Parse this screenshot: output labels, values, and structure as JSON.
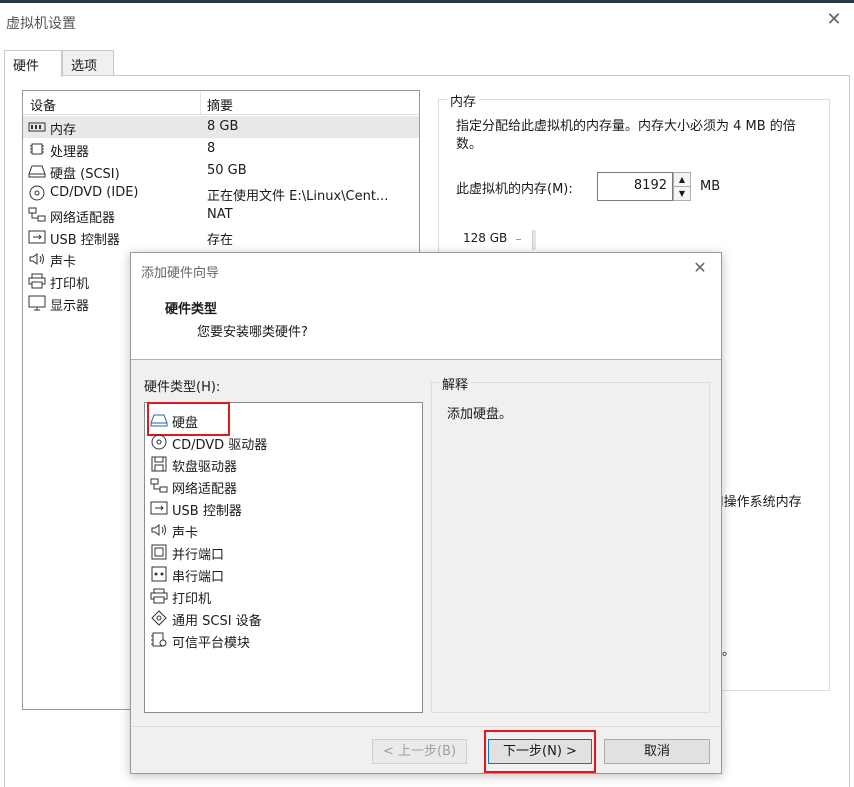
{
  "window": {
    "title": "虚拟机设置",
    "close": "✕"
  },
  "tabs": [
    {
      "label": "硬件",
      "active": true
    },
    {
      "label": "选项",
      "active": false
    }
  ],
  "device_list": {
    "columns": [
      "设备",
      "摘要"
    ],
    "rows": [
      {
        "name": "内存",
        "summary": "8 GB",
        "icon": "memory-icon",
        "selected": true
      },
      {
        "name": "处理器",
        "summary": "8",
        "icon": "processor-icon"
      },
      {
        "name": "硬盘 (SCSI)",
        "summary": "50 GB",
        "icon": "hard-disk-icon"
      },
      {
        "name": "CD/DVD (IDE)",
        "summary": "正在使用文件 E:\\Linux\\Cent...",
        "icon": "cd-dvd-icon"
      },
      {
        "name": "网络适配器",
        "summary": "NAT",
        "icon": "network-adapter-icon"
      },
      {
        "name": "USB 控制器",
        "summary": "存在",
        "icon": "usb-icon"
      },
      {
        "name": "声卡",
        "summary": "",
        "icon": "sound-card-icon"
      },
      {
        "name": "打印机",
        "summary": "",
        "icon": "printer-icon"
      },
      {
        "name": "显示器",
        "summary": "",
        "icon": "display-icon"
      }
    ]
  },
  "memory": {
    "group_title": "内存",
    "description": "指定分配给此虚拟机的内存量。内存大小必须为 4 MB 的倍数。",
    "label": "此虚拟机的内存(M):",
    "value": "8192",
    "unit": "MB",
    "scale_max": "128 GB",
    "fragment1": "l操作系统内存",
    "fragment2": "。"
  },
  "dialog": {
    "title": "添加硬件向导",
    "close": "✕",
    "heading": "硬件类型",
    "subheading": "您要安装哪类硬件?",
    "list_label": "硬件类型(H):",
    "items": [
      {
        "name": "硬盘",
        "icon": "hard-disk-icon"
      },
      {
        "name": "CD/DVD 驱动器",
        "icon": "cd-dvd-icon"
      },
      {
        "name": "软盘驱动器",
        "icon": "floppy-icon"
      },
      {
        "name": "网络适配器",
        "icon": "network-adapter-icon"
      },
      {
        "name": "USB 控制器",
        "icon": "usb-icon"
      },
      {
        "name": "声卡",
        "icon": "sound-card-icon"
      },
      {
        "name": "并行端口",
        "icon": "parallel-port-icon"
      },
      {
        "name": "串行端口",
        "icon": "serial-port-icon"
      },
      {
        "name": "打印机",
        "icon": "printer-icon"
      },
      {
        "name": "通用 SCSI 设备",
        "icon": "scsi-icon"
      },
      {
        "name": "可信平台模块",
        "icon": "tpm-icon"
      }
    ],
    "explain_title": "解释",
    "explain_text": "添加硬盘。",
    "buttons": {
      "back": "< 上一步(B)",
      "next": "下一步(N) >",
      "cancel": "取消"
    }
  },
  "colors": {
    "highlight": "#e0191f",
    "accent": "#0078d7"
  }
}
